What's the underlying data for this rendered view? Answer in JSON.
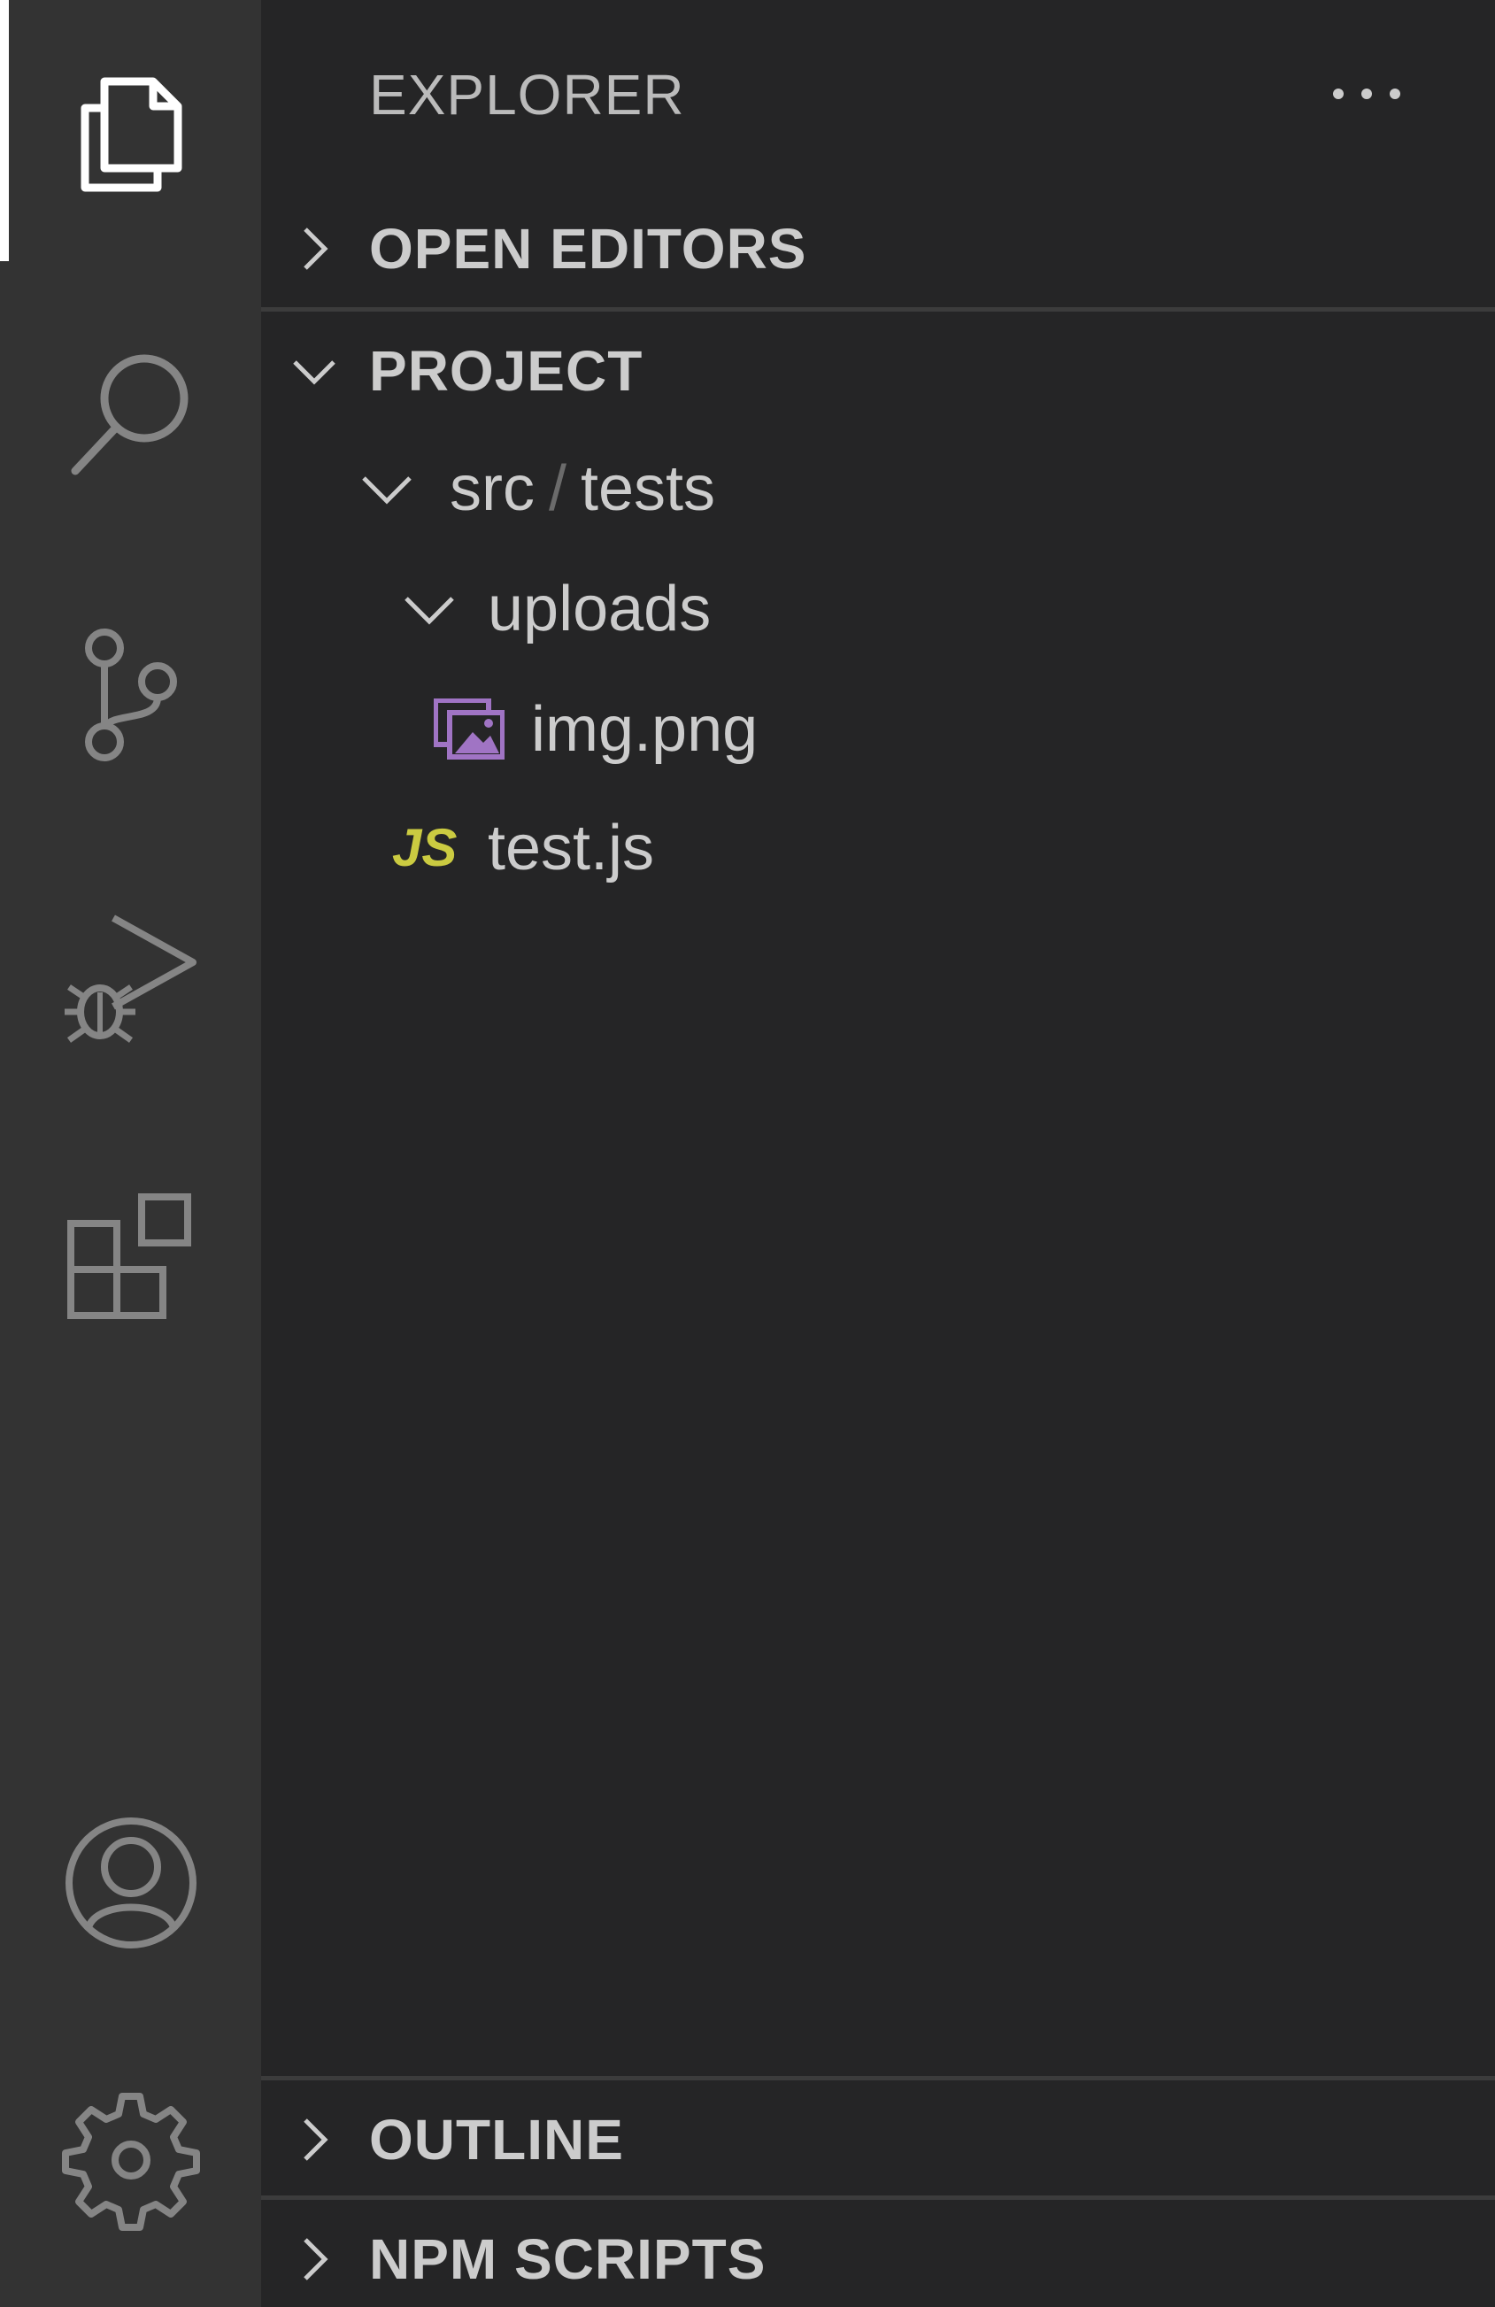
{
  "sidebar": {
    "title": "EXPLORER",
    "more_actions": "···"
  },
  "sections": {
    "open_editors": "OPEN EDITORS",
    "project": "PROJECT",
    "outline": "OUTLINE",
    "npm_scripts": "NPM SCRIPTS"
  },
  "tree": {
    "folder_root_part1": "src",
    "folder_separator": "/",
    "folder_root_part2": "tests",
    "subfolder": "uploads",
    "file_image": "img.png",
    "file_js": "test.js",
    "js_badge": "JS"
  },
  "activity_bar": {
    "items": [
      {
        "icon": "files-icon",
        "active": true
      },
      {
        "icon": "search-icon",
        "active": false
      },
      {
        "icon": "source-control-icon",
        "active": false
      },
      {
        "icon": "run-debug-icon",
        "active": false
      },
      {
        "icon": "extensions-icon",
        "active": false
      },
      {
        "icon": "account-icon",
        "active": false
      },
      {
        "icon": "gear-icon",
        "active": false
      }
    ]
  },
  "colors": {
    "activity_bar_bg": "#333333",
    "sidebar_bg": "#252526",
    "icon_color": "#858585",
    "active_icon_color": "#ffffff",
    "js_color": "#cbcb41",
    "image_icon_color": "#a074c4"
  }
}
